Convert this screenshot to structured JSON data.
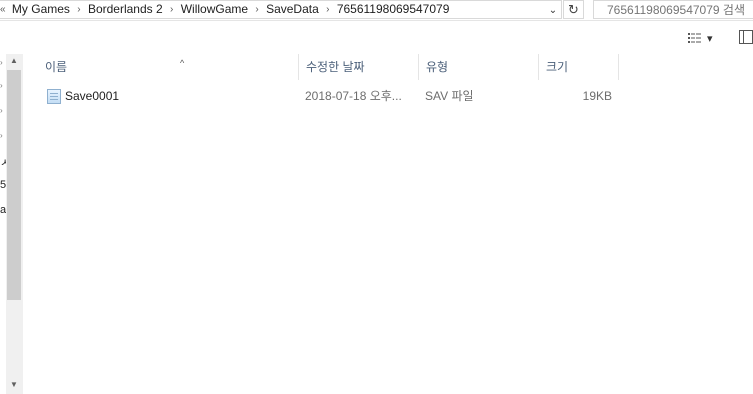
{
  "address_bar": {
    "overflow_marker": "«",
    "crumbs": [
      "My Games",
      "Borderlands 2",
      "WillowGame",
      "SaveData",
      "76561198069547079"
    ],
    "separator": "›",
    "dropdown_glyph": "⌄",
    "refresh_glyph": "↻"
  },
  "search": {
    "placeholder": "76561198069547079 검색"
  },
  "toolbar": {
    "view_icon": "details-view-icon",
    "view_dropdown_glyph": "▾",
    "preview_icon": "preview-pane-icon"
  },
  "nav_pane": {
    "fragments": [
      "ㅅ",
      "5·",
      "ar"
    ],
    "scroll_up_glyph": "▲",
    "scroll_down_glyph": "▼",
    "expand_glyph": "›"
  },
  "columns": {
    "name": "이름",
    "date": "수정한 날짜",
    "type": "유형",
    "size": "크기",
    "sort_glyph": "^"
  },
  "files": [
    {
      "name": "Save0001",
      "date": "2018-07-18 오후...",
      "type": "SAV 파일",
      "size": "19KB",
      "icon": "file-icon"
    }
  ]
}
